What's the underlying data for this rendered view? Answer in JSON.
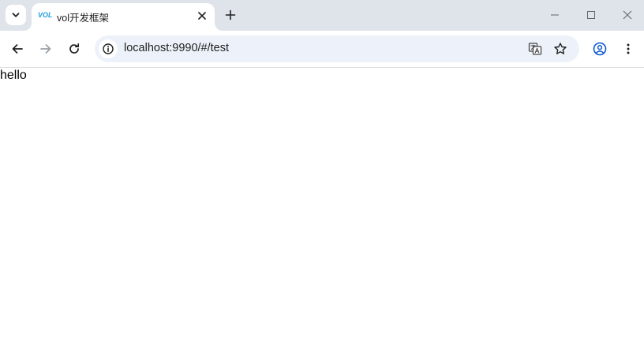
{
  "browser": {
    "tab": {
      "favicon_text": "VOL",
      "title": "vol开发框架"
    },
    "address_bar": {
      "url": "localhost:9990/#/test"
    }
  },
  "page": {
    "body_text": "hello"
  },
  "icons": {
    "tab_search": "chevron-down-icon",
    "tab_close": "close-icon",
    "new_tab": "plus-icon",
    "minimize": "minimize-icon",
    "maximize": "maximize-icon",
    "close_window": "close-icon",
    "back": "arrow-left-icon",
    "forward": "arrow-right-icon",
    "reload": "reload-icon",
    "site_info": "info-icon",
    "translate": "translate-icon",
    "bookmark": "star-icon",
    "profile": "profile-icon",
    "menu": "kebab-menu-icon"
  },
  "colors": {
    "tabstrip": "#dfe3ea",
    "omnibox": "#edf2fa",
    "favicon": "#1e9fe0",
    "icon": "#474747"
  }
}
